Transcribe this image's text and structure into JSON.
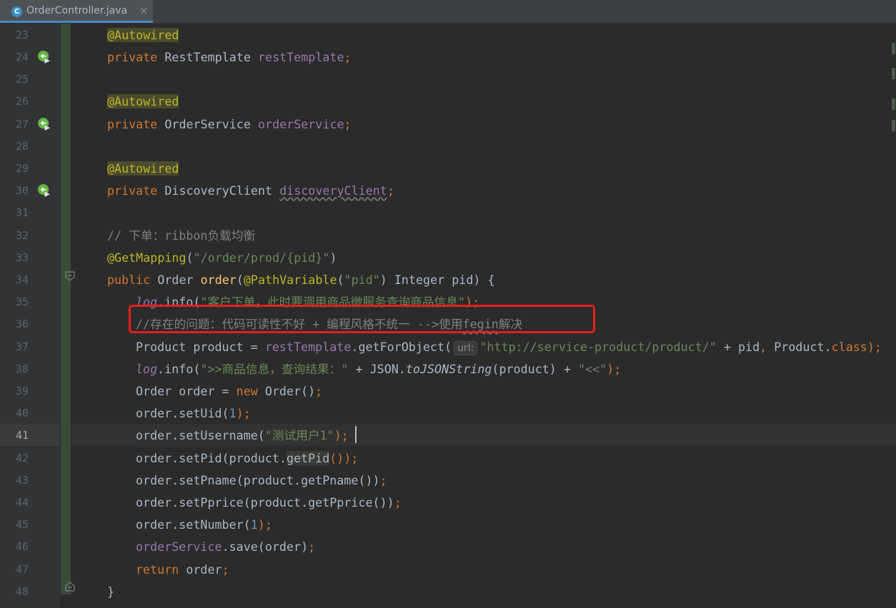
{
  "tab": {
    "filename": "OrderController.java",
    "icon": "class-icon",
    "icon_letter": "C",
    "close": "×"
  },
  "colors": {
    "annotation": "#bbb529",
    "keyword": "#cc7832",
    "field": "#9876aa",
    "string": "#6a8759",
    "comment": "#808080",
    "highlight_box": "#e5201c"
  },
  "lines": {
    "l23": {
      "num": "23",
      "ann": "@Autowired"
    },
    "l24": {
      "num": "24",
      "kw": "private",
      "type": "RestTemplate",
      "field": "restTemplate",
      "semi": ";"
    },
    "l25": {
      "num": "25"
    },
    "l26": {
      "num": "26",
      "ann": "@Autowired"
    },
    "l27": {
      "num": "27",
      "kw": "private",
      "type": "OrderService",
      "field": "orderService",
      "semi": ";"
    },
    "l28": {
      "num": "28"
    },
    "l29": {
      "num": "29",
      "ann": "@Autowired"
    },
    "l30": {
      "num": "30",
      "kw": "private",
      "type": "DiscoveryClient",
      "field": "discoveryClient",
      "semi": ";"
    },
    "l31": {
      "num": "31"
    },
    "l32": {
      "num": "32",
      "comment": "// 下单：ribbon负载均衡"
    },
    "l33": {
      "num": "33",
      "ann": "@GetMapping",
      "open": "(",
      "str": "\"/order/prod/{pid}\"",
      "close": ")"
    },
    "l34": {
      "num": "34",
      "kw": "public",
      "type": "Order",
      "method": "order",
      "open": "(",
      "ann": "@PathVariable",
      "open2": "(",
      "str": "\"pid\"",
      "close2": ")",
      "param": " Integer pid) {"
    },
    "l35": {
      "num": "35",
      "log": "log",
      "call": ".info(",
      "str": "\"客户下单，此时要调用商品微服务查询商品信息\"",
      "end": ");"
    },
    "l36": {
      "num": "36",
      "comment_a": "//存在的问题：代码可读性不好 + 编程风格不统一 -->使用",
      "comment_b": "fegin",
      "comment_c": "解决"
    },
    "l37": {
      "num": "37",
      "pre": "Product product = ",
      "field": "restTemplate",
      "call": ".getForObject(",
      "hint": "url:",
      "str": "\"http://service-product/product/\"",
      "mid": " + pid",
      "comma": ",",
      "cls": " Product.",
      "kw": "class",
      "end": ");"
    },
    "l38": {
      "num": "38",
      "log": "log",
      "call": ".info(",
      "str": "\">>商品信息，查询结果：\"",
      "mid": " + JSON.",
      "static": "toJSONString",
      "arg": "(product) + ",
      "str2": "\"<<\"",
      "end": ");"
    },
    "l39": {
      "num": "39",
      "pre": "Order order = ",
      "kw": "new",
      "post": " Order()",
      "semi": ";"
    },
    "l40": {
      "num": "40",
      "pre": "order.setUid(",
      "n": "1",
      "end": ");"
    },
    "l41": {
      "num": "41",
      "pre": "order.setUsername(",
      "str": "\"测试用户1\"",
      "end": ");"
    },
    "l42": {
      "num": "42",
      "pre": "order.setPid(product.",
      "hl": "getPid",
      "end": "());"
    },
    "l43": {
      "num": "43",
      "pre": "order.setPname(product.getPname())",
      "semi": ";"
    },
    "l44": {
      "num": "44",
      "pre": "order.setPprice(product.getPprice())",
      "semi": ";"
    },
    "l45": {
      "num": "45",
      "pre": "order.setNumber(",
      "n": "1",
      "end": ");"
    },
    "l46": {
      "num": "46",
      "field": "orderService",
      "post": ".save(order)",
      "semi": ";"
    },
    "l47": {
      "num": "47",
      "kw": "return",
      "post": " order",
      "semi": ";"
    },
    "l48": {
      "num": "48",
      "brace": "}"
    }
  }
}
